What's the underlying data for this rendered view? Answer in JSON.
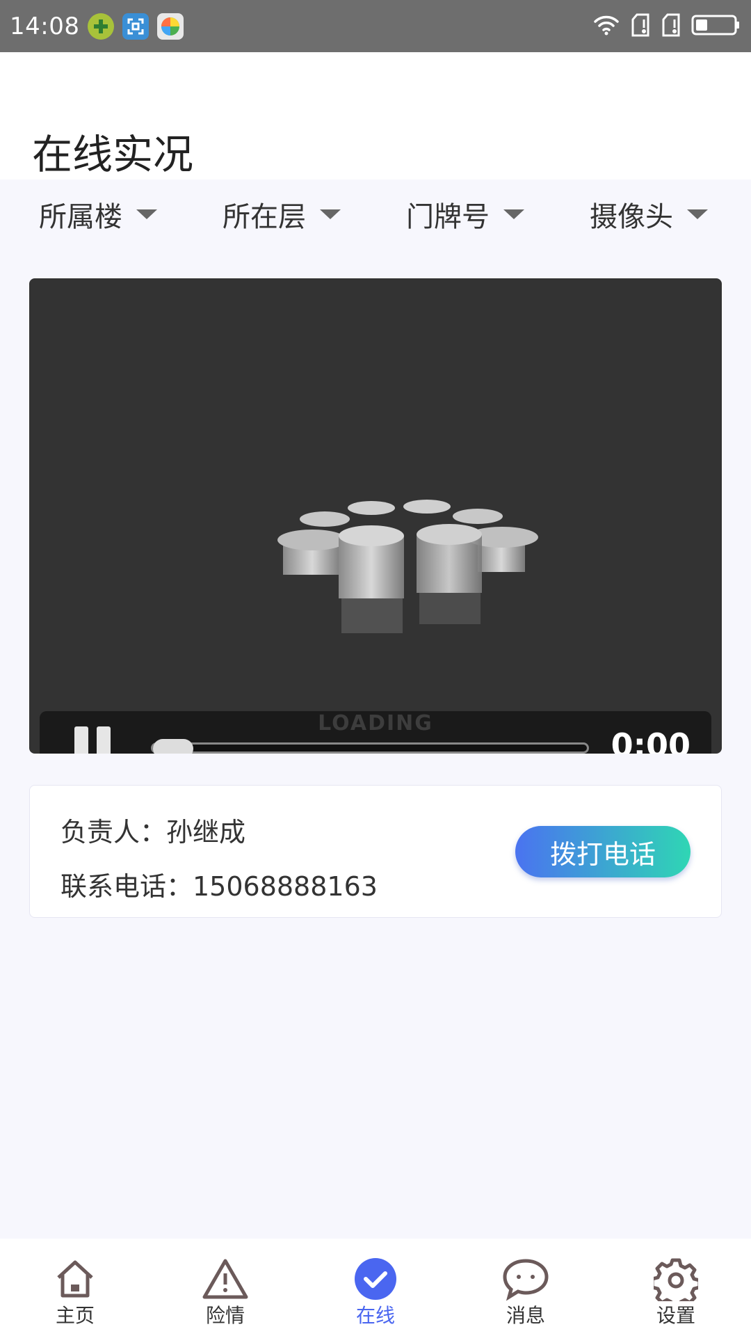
{
  "status_bar": {
    "time": "14:08",
    "app_icons": [
      "plus-icon",
      "scan-icon",
      "ball-icon"
    ],
    "system_icons": [
      "wifi-icon",
      "sim-icon",
      "sim-icon",
      "battery-icon"
    ]
  },
  "header": {
    "title": "在线实况"
  },
  "filters": [
    {
      "label": "所属楼"
    },
    {
      "label": "所在层"
    },
    {
      "label": "门牌号"
    },
    {
      "label": "摄像头"
    }
  ],
  "video": {
    "loading_text": "LOADING",
    "time": "0:00",
    "progress": 0
  },
  "contact": {
    "person_label": "负责人：孙继成",
    "phone_label": "联系电话：15068888163",
    "call_button": "拨打电话"
  },
  "tabs": [
    {
      "label": "主页",
      "icon": "home-icon",
      "active": false
    },
    {
      "label": "险情",
      "icon": "warning-icon",
      "active": false
    },
    {
      "label": "在线",
      "icon": "check-circle-icon",
      "active": true
    },
    {
      "label": "消息",
      "icon": "chat-icon",
      "active": false
    },
    {
      "label": "设置",
      "icon": "gear-icon",
      "active": false
    }
  ],
  "colors": {
    "accent": "#4a66f0",
    "button_gradient_start": "#4a73f0",
    "button_gradient_end": "#2fd6b4",
    "video_bg": "#333333"
  }
}
